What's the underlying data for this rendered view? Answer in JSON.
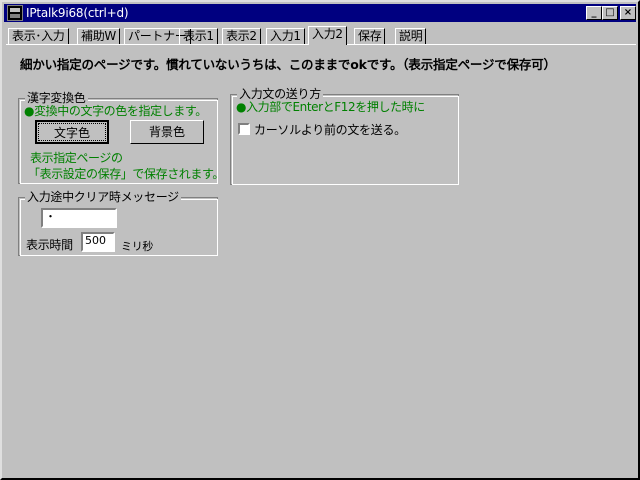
{
  "window": {
    "title": "IPtalk9i68(ctrl+d)",
    "buttons": {
      "minimize": "_",
      "maximize": "□",
      "close": "×"
    }
  },
  "tabs": [
    {
      "label": "表示･入力"
    },
    {
      "label": "補助W"
    },
    {
      "label": "パートナー"
    },
    {
      "label": "表示1"
    },
    {
      "label": "表示2"
    },
    {
      "label": "入力1"
    },
    {
      "label": "入力2",
      "active": true
    },
    {
      "label": "保存"
    },
    {
      "label": "説明"
    }
  ],
  "intro": "細かい指定のページです。慣れていないうちは、このままでokです。（表示指定ページで保存可）",
  "kanji_group": {
    "legend": "漢字変換色",
    "note": "●変換中の文字の色を指定します。",
    "text_color_button": "文字色",
    "bg_color_button": "背景色",
    "save_note_1": "表示指定ページの",
    "save_note_2": "「表示設定の保存」で保存されます。"
  },
  "send_group": {
    "legend": "入力文の送り方",
    "note": "●入力部でEnterとF12を押した時に",
    "checkbox_label": "カーソルより前の文を送る。",
    "checked": false
  },
  "clear_group": {
    "legend": "入力途中クリア時メッセージ",
    "message_value": "・",
    "time_label": "表示時間",
    "time_value": "500",
    "time_unit": "ミリ秒"
  },
  "colors": {
    "title_bar": "#000080",
    "note_text": "#008000",
    "face": "#c0c0c0"
  }
}
